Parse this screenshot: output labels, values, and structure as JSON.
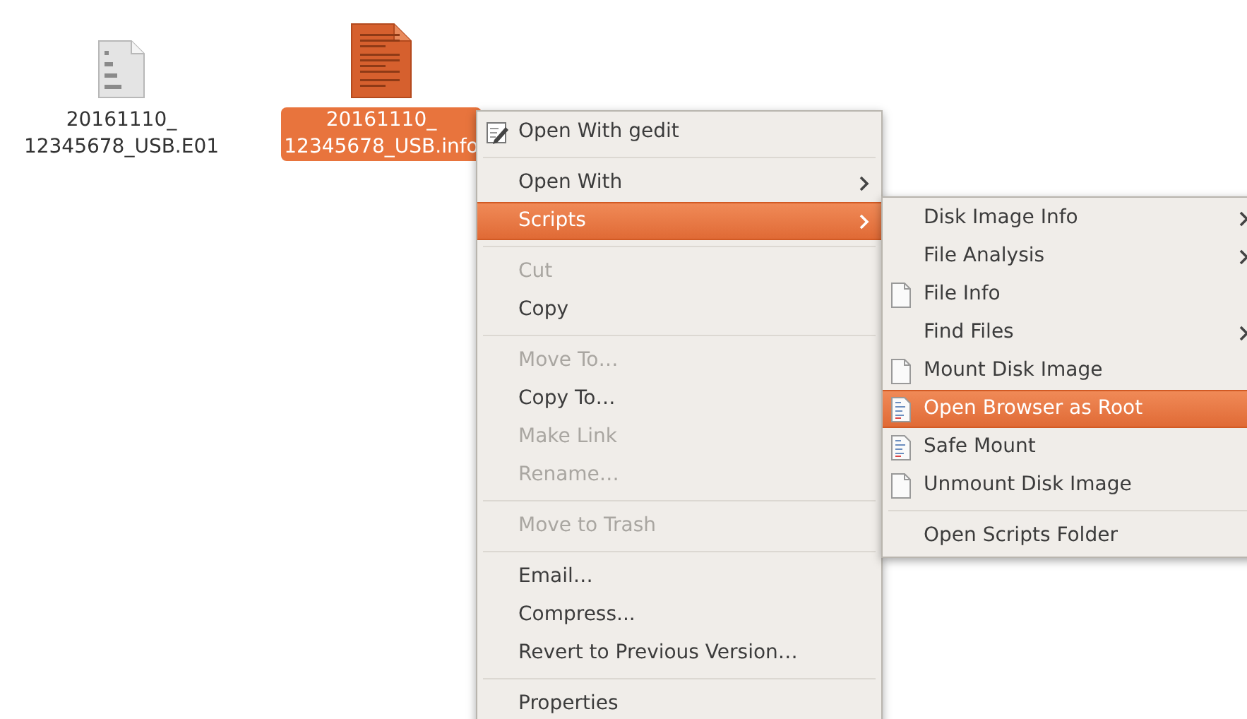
{
  "desktop_icons": [
    {
      "label_lines": [
        "20161110_",
        "12345678_USB.E01"
      ],
      "kind": "binary",
      "selected": false
    },
    {
      "label_lines": [
        "20161110_",
        "12345678_USB.info"
      ],
      "kind": "text",
      "selected": true
    }
  ],
  "context_menu": {
    "items": [
      {
        "kind": "edit",
        "label": "Open With gedit",
        "submenu": false,
        "disabled": false,
        "selected": false
      },
      {
        "kind": "separator"
      },
      {
        "kind": "plain",
        "label": "Open With",
        "submenu": true,
        "disabled": false,
        "selected": false
      },
      {
        "kind": "plain",
        "label": "Scripts",
        "submenu": true,
        "disabled": false,
        "selected": true
      },
      {
        "kind": "separator"
      },
      {
        "kind": "plain",
        "label": "Cut",
        "submenu": false,
        "disabled": true,
        "selected": false
      },
      {
        "kind": "plain",
        "label": "Copy",
        "submenu": false,
        "disabled": false,
        "selected": false
      },
      {
        "kind": "separator"
      },
      {
        "kind": "plain",
        "label": "Move To…",
        "submenu": false,
        "disabled": true,
        "selected": false
      },
      {
        "kind": "plain",
        "label": "Copy To…",
        "submenu": false,
        "disabled": false,
        "selected": false
      },
      {
        "kind": "plain",
        "label": "Make Link",
        "submenu": false,
        "disabled": true,
        "selected": false
      },
      {
        "kind": "plain",
        "label": "Rename…",
        "submenu": false,
        "disabled": true,
        "selected": false
      },
      {
        "kind": "separator"
      },
      {
        "kind": "plain",
        "label": "Move to Trash",
        "submenu": false,
        "disabled": true,
        "selected": false
      },
      {
        "kind": "separator"
      },
      {
        "kind": "plain",
        "label": "Email…",
        "submenu": false,
        "disabled": false,
        "selected": false
      },
      {
        "kind": "plain",
        "label": "Compress...",
        "submenu": false,
        "disabled": false,
        "selected": false
      },
      {
        "kind": "plain",
        "label": "Revert to Previous Version…",
        "submenu": false,
        "disabled": false,
        "selected": false
      },
      {
        "kind": "separator"
      },
      {
        "kind": "plain",
        "label": "Properties",
        "submenu": false,
        "disabled": false,
        "selected": false
      }
    ]
  },
  "scripts_submenu": {
    "items": [
      {
        "kind": "plain",
        "label": "Disk Image Info",
        "submenu": true,
        "disabled": false,
        "selected": false
      },
      {
        "kind": "plain",
        "label": "File Analysis",
        "submenu": true,
        "disabled": false,
        "selected": false
      },
      {
        "kind": "file",
        "label": "File Info",
        "submenu": false,
        "disabled": false,
        "selected": false
      },
      {
        "kind": "plain",
        "label": "Find Files",
        "submenu": true,
        "disabled": false,
        "selected": false
      },
      {
        "kind": "file",
        "label": "Mount Disk Image",
        "submenu": false,
        "disabled": false,
        "selected": false
      },
      {
        "kind": "script",
        "label": "Open Browser as Root",
        "submenu": false,
        "disabled": false,
        "selected": true
      },
      {
        "kind": "script",
        "label": "Safe Mount",
        "submenu": false,
        "disabled": false,
        "selected": false
      },
      {
        "kind": "file",
        "label": "Unmount Disk Image",
        "submenu": false,
        "disabled": false,
        "selected": false
      },
      {
        "kind": "separator"
      },
      {
        "kind": "plain",
        "label": "Open Scripts Folder",
        "submenu": false,
        "disabled": false,
        "selected": false
      }
    ]
  }
}
